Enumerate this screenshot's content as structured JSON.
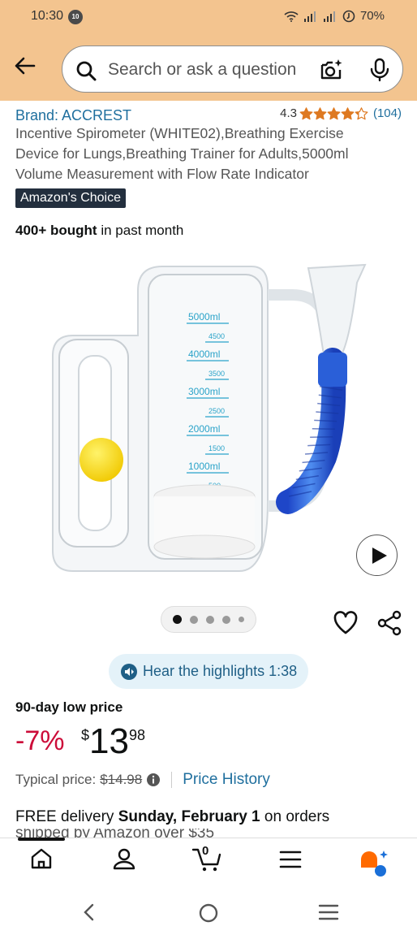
{
  "status_bar": {
    "time": "10:30",
    "notification_badge": "10",
    "battery": "70%"
  },
  "search": {
    "placeholder": "Search or ask a question"
  },
  "product": {
    "brand": "Brand: ACCREST",
    "rating_value": "4.3",
    "rating_count": "(104)",
    "stars": 4.3,
    "title_lines": [
      "Incentive Spirometer (WHITE02),Breathing Exercise",
      "Device for Lungs,Breathing Trainer for Adults,5000ml",
      "Volume Measurement with Flow Rate Indicator"
    ],
    "badge": "Amazon's Choice",
    "bought_bold": "400+ bought",
    "bought_rest": " in past month",
    "image": {
      "scale_labels": [
        "5000ml",
        "4500",
        "4000ml",
        "3500",
        "3000ml",
        "2500",
        "2000ml",
        "1500",
        "1000ml",
        "500"
      ]
    },
    "carousel": {
      "count": 5,
      "active": 0
    }
  },
  "highlights": {
    "label": "Hear the highlights 1:38"
  },
  "price": {
    "low_label": "90-day low price",
    "discount": "-7%",
    "symbol": "$",
    "whole": "13",
    "fraction": "98",
    "typical_label": "Typical price:",
    "typical_value": "$14.98",
    "history_link": "Price History"
  },
  "delivery": {
    "prefix": "FREE delivery ",
    "date": "Sunday, February 1",
    "suffix": " on orders",
    "line2": "shipped by Amazon over $35"
  },
  "bottom_nav": {
    "cart_count": "0"
  },
  "colors": {
    "header": "#f3c48f",
    "link": "#1f6f9e",
    "discount": "#cc0c39",
    "star": "#de7921",
    "badge": "#232f3e"
  }
}
